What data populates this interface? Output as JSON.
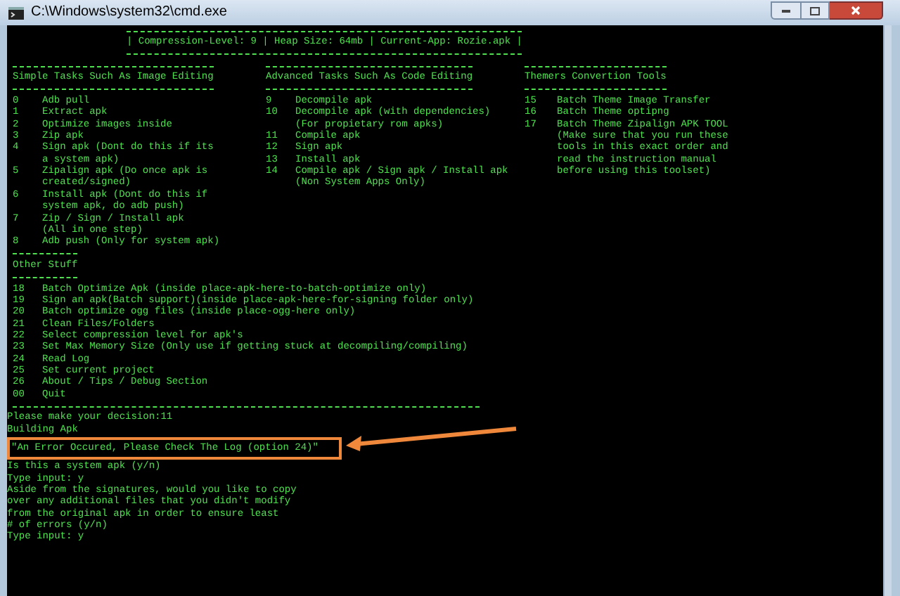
{
  "window": {
    "title": "C:\\Windows\\system32\\cmd.exe"
  },
  "status_header": "| Compression-Level: 9 | Heap Size: 64mb | Current-App: Rozie.apk |",
  "columns": [
    {
      "heading": "Simple Tasks Such As Image Editing",
      "items": [
        {
          "number": "0",
          "lines": [
            "Adb pull"
          ]
        },
        {
          "number": "1",
          "lines": [
            "Extract apk"
          ]
        },
        {
          "number": "2",
          "lines": [
            "Optimize images inside"
          ]
        },
        {
          "number": "3",
          "lines": [
            "Zip apk"
          ]
        },
        {
          "number": "4",
          "lines": [
            "Sign apk (Dont do this if its",
            "a system apk)"
          ]
        },
        {
          "number": "5",
          "lines": [
            "Zipalign apk (Do once apk is",
            "created/signed)"
          ]
        },
        {
          "number": "6",
          "lines": [
            "Install apk (Dont do this if",
            "system apk, do adb push)"
          ]
        },
        {
          "number": "7",
          "lines": [
            "Zip / Sign / Install apk",
            "(All in one step)"
          ]
        },
        {
          "number": "8",
          "lines": [
            "Adb push (Only for system apk)"
          ]
        }
      ]
    },
    {
      "heading": "Advanced Tasks Such As Code Editing",
      "items": [
        {
          "number": "9",
          "lines": [
            "Decompile apk"
          ]
        },
        {
          "number": "10",
          "lines": [
            "Decompile apk (with dependencies)",
            "(For propietary rom apks)"
          ]
        },
        {
          "number": "11",
          "lines": [
            "Compile apk"
          ]
        },
        {
          "number": "12",
          "lines": [
            "Sign apk"
          ]
        },
        {
          "number": "13",
          "lines": [
            "Install apk"
          ]
        },
        {
          "number": "14",
          "lines": [
            "Compile apk / Sign apk / Install apk",
            "(Non System Apps Only)"
          ]
        }
      ]
    },
    {
      "heading": "Themers Convertion Tools",
      "items": [
        {
          "number": "15",
          "lines": [
            "Batch Theme Image Transfer"
          ]
        },
        {
          "number": "16",
          "lines": [
            "Batch Theme optipng"
          ]
        },
        {
          "number": "17",
          "lines": [
            "Batch Theme Zipalign APK TOOL",
            "(Make sure that you run these",
            "tools in this exact order and",
            "read the instruction manual",
            "before using this toolset)"
          ]
        }
      ]
    }
  ],
  "other_stuff": {
    "heading": "Other Stuff",
    "items": [
      {
        "number": "18",
        "lines": [
          "Batch Optimize Apk (inside place-apk-here-to-batch-optimize only)"
        ]
      },
      {
        "number": "19",
        "lines": [
          "Sign an apk(Batch support)(inside place-apk-here-for-signing folder only)"
        ]
      },
      {
        "number": "20",
        "lines": [
          "Batch optimize ogg files (inside place-ogg-here only)"
        ]
      },
      {
        "number": "21",
        "lines": [
          "Clean Files/Folders"
        ]
      },
      {
        "number": "22",
        "lines": [
          "Select compression level for apk's"
        ]
      },
      {
        "number": "23",
        "lines": [
          "Set Max Memory Size (Only use if getting stuck at decompiling/compiling)"
        ]
      },
      {
        "number": "24",
        "lines": [
          "Read Log"
        ]
      },
      {
        "number": "25",
        "lines": [
          "Set current project"
        ]
      },
      {
        "number": "26",
        "lines": [
          "About / Tips / Debug Section"
        ]
      },
      {
        "number": "00",
        "lines": [
          "Quit"
        ]
      }
    ]
  },
  "console_lines": [
    {
      "text": "Please make your decision:11",
      "highlighted": false
    },
    {
      "text": "Building Apk",
      "highlighted": false
    },
    {
      "text": "\"An Error Occured, Please Check The Log (option 24)\"",
      "highlighted": true
    },
    {
      "text": "Is this a system apk (y/n)",
      "highlighted": false
    },
    {
      "text": "Type input: y",
      "highlighted": false
    },
    {
      "text": "Aside from the signatures, would you like to copy",
      "highlighted": false
    },
    {
      "text": "over any additional files that you didn't modify",
      "highlighted": false
    },
    {
      "text": "from the original apk in order to ensure least",
      "highlighted": false
    },
    {
      "text": "# of errors (y/n)",
      "highlighted": false
    },
    {
      "text": "Type input: y",
      "highlighted": false
    }
  ]
}
